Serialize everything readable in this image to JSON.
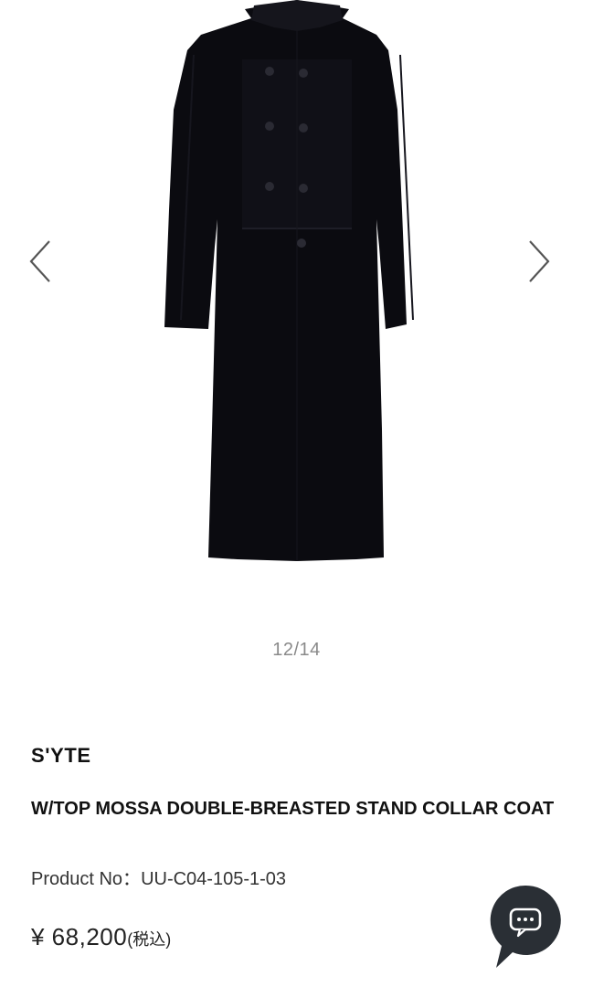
{
  "gallery": {
    "counter": "12/14",
    "image": "black double-breasted stand collar coat",
    "prev_icon": "chevron-left-icon",
    "next_icon": "chevron-right-icon"
  },
  "product": {
    "brand": "S'YTE",
    "title": "W/TOP MOSSA DOUBLE-BREASTED STAND COLLAR COAT",
    "product_no_label": "Product No：",
    "product_no": "UU-C04-105-1-03",
    "price": "¥ 68,200",
    "tax_note": "(税込)"
  },
  "chat": {
    "icon": "chat-bubble-icon",
    "color": "#2a2f35"
  },
  "colors": {
    "coat": "#0b0b10",
    "text": "#111111",
    "muted": "#8a8a8a"
  }
}
